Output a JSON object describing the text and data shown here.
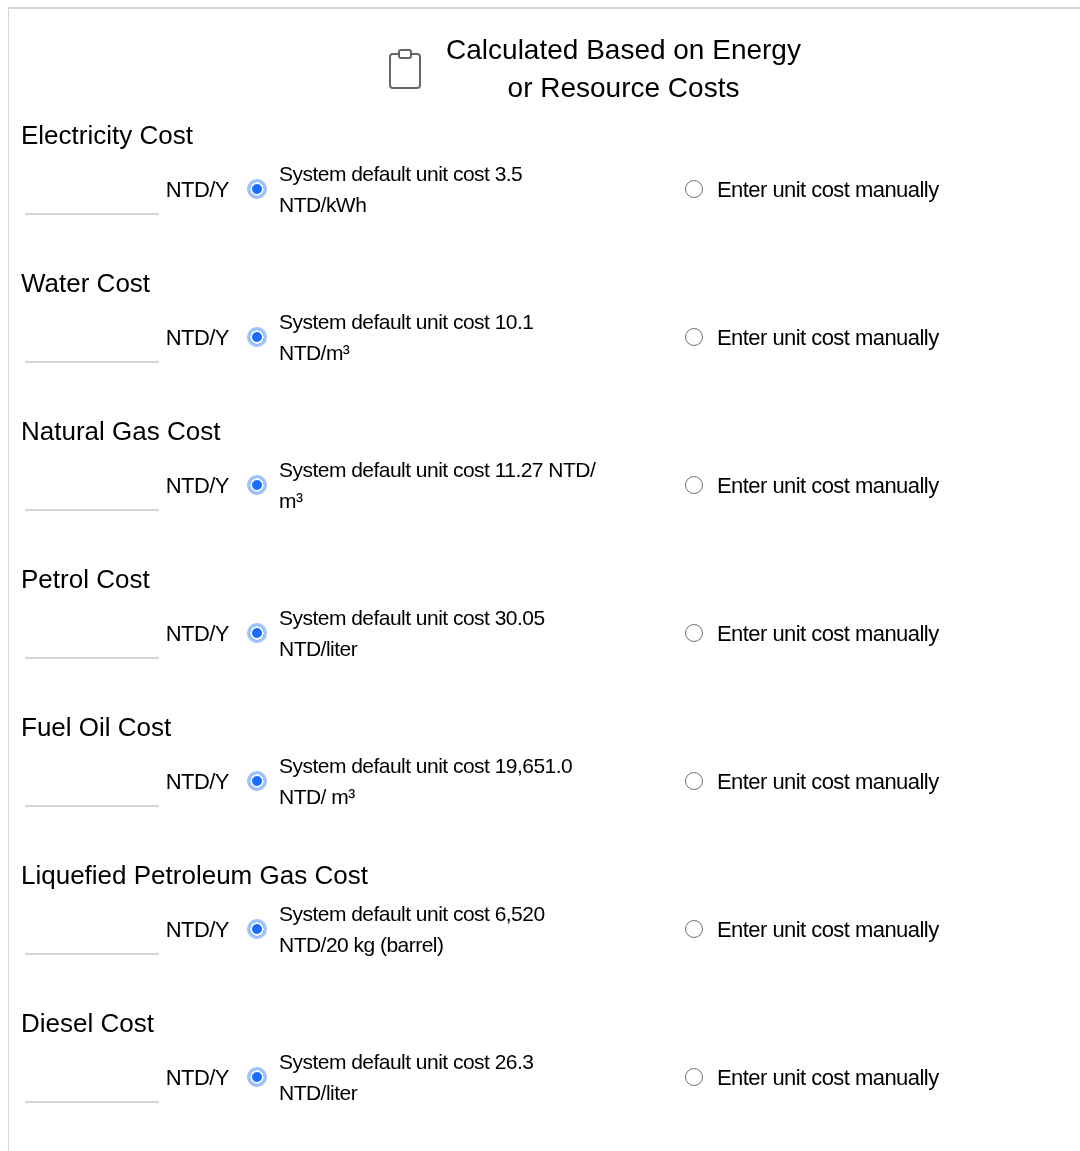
{
  "header": {
    "title_lines": [
      "Calculated Based on Energy",
      "or Resource Costs"
    ]
  },
  "sections": [
    {
      "title": "Electricity Cost",
      "unit": "NTD/Y",
      "default_option": {
        "label": "System default unit cost 3.5 NTD/kWh",
        "selected": true
      },
      "manual_option": {
        "label": "Enter unit cost manually",
        "selected": false
      }
    },
    {
      "title": "Water Cost",
      "unit": "NTD/Y",
      "default_option": {
        "label": "System default unit cost 10.1 NTD/m³",
        "selected": true
      },
      "manual_option": {
        "label": "Enter unit cost manually",
        "selected": false
      }
    },
    {
      "title": "Natural Gas Cost",
      "unit": "NTD/Y",
      "default_option": {
        "label": "System default unit cost 11.27 NTD/ m³",
        "selected": true
      },
      "manual_option": {
        "label": "Enter unit cost manually",
        "selected": false
      }
    },
    {
      "title": "Petrol Cost",
      "unit": "NTD/Y",
      "default_option": {
        "label": "System default unit cost 30.05 NTD/liter",
        "selected": true
      },
      "manual_option": {
        "label": "Enter unit cost manually",
        "selected": false
      }
    },
    {
      "title": "Fuel Oil Cost",
      "unit": "NTD/Y",
      "default_option": {
        "label": "System default unit cost 19,651.0 NTD/ m³",
        "selected": true
      },
      "manual_option": {
        "label": "Enter unit cost manually",
        "selected": false
      }
    },
    {
      "title": "Liquefied Petroleum Gas Cost",
      "unit": "NTD/Y",
      "default_option": {
        "label": "System default unit cost 6,520 NTD/20 kg (barrel)",
        "selected": true
      },
      "manual_option": {
        "label": "Enter unit cost manually",
        "selected": false
      }
    },
    {
      "title": "Diesel Cost",
      "unit": "NTD/Y",
      "default_option": {
        "label": "System default unit cost 26.3 NTD/liter",
        "selected": true
      },
      "manual_option": {
        "label": "Enter unit cost manually",
        "selected": false
      }
    }
  ]
}
